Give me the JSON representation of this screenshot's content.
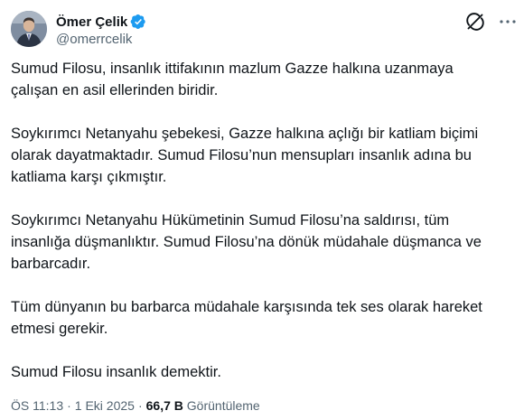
{
  "author": {
    "display_name": "Ömer Çelik",
    "handle": "@omerrcelik",
    "verified_color": "#1d9bf0"
  },
  "icons": {
    "avatar": "avatar-photo",
    "verified": "verified-badge-icon",
    "grok": "grok-icon",
    "more": "more-dots-icon"
  },
  "body": {
    "paragraphs": [
      [
        "Sumud Filosu, insanlık ittifakının mazlum Gazze halkına uzanmaya",
        "çalışan en asil ellerinden biridir."
      ],
      [
        "Soykırımcı Netanyahu şebekesi, Gazze halkına açlığı bir katliam biçimi",
        "olarak dayatmaktadır. Sumud Filosu’nun mensupları insanlık adına bu",
        "katliama karşı çıkmıştır."
      ],
      [
        "Soykırımcı Netanyahu Hükümetinin Sumud Filosu’na saldırısı, tüm",
        "insanlığa düşmanlıktır. Sumud Filosu’na dönük müdahale düşmanca ve",
        "barbarcadır."
      ],
      [
        "Tüm dünyanın bu barbarca müdahale karşısında tek ses olarak hareket",
        "etmesi gerekir."
      ],
      [
        "Sumud Filosu insanlık demektir."
      ]
    ]
  },
  "meta": {
    "time": "ÖS 11:13",
    "separator": "·",
    "date": "1 Eki 2025",
    "views_count": "66,7 B",
    "views_label": "Görüntüleme"
  },
  "colors": {
    "text": "#0f1419",
    "secondary": "#536471",
    "accent": "#1d9bf0"
  }
}
